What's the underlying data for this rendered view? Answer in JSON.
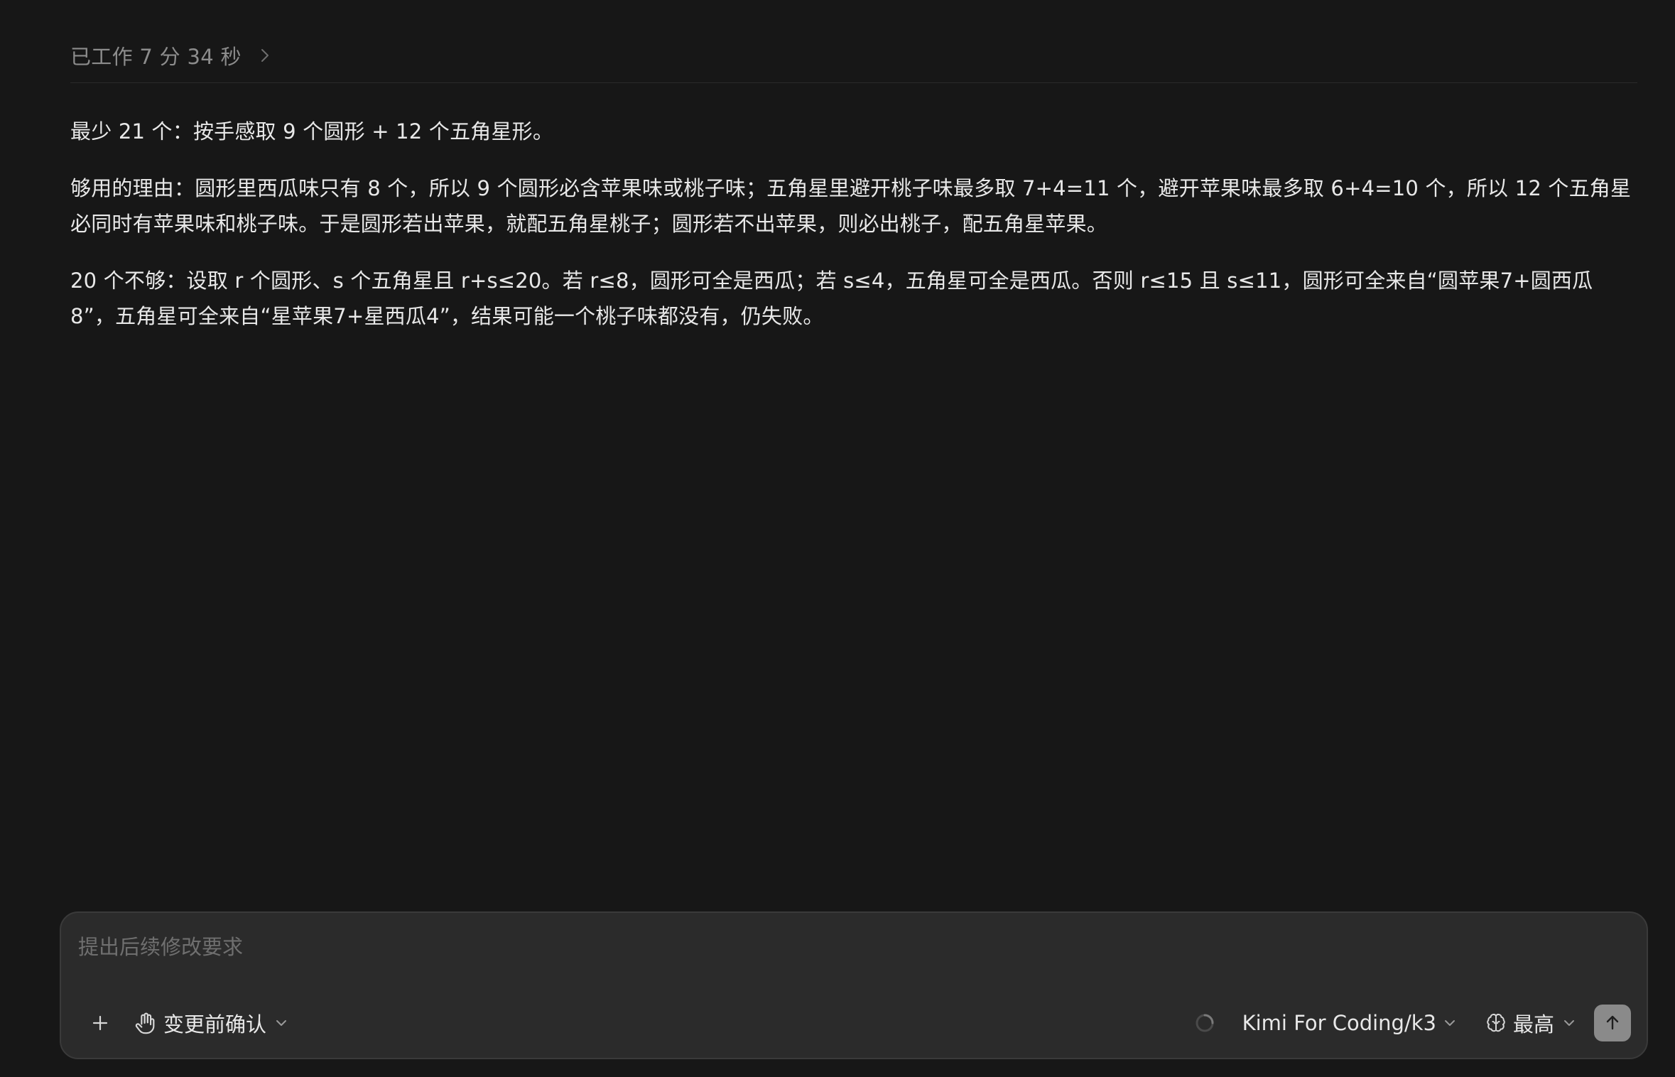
{
  "header": {
    "worked_label": "已工作 7 分 34 秒"
  },
  "message": {
    "paragraphs": [
      "最少 21 个：按手感取 9 个圆形 + 12 个五角星形。",
      "够用的理由：圆形里西瓜味只有 8 个，所以 9 个圆形必含苹果味或桃子味；五角星里避开桃子味最多取 7+4=11 个，避开苹果味最多取 6+4=10 个，所以 12 个五角星必同时有苹果味和桃子味。于是圆形若出苹果，就配五角星桃子；圆形若不出苹果，则必出桃子，配五角星苹果。",
      "20 个不够：设取 r 个圆形、s 个五角星且 r+s≤20。若 r≤8，圆形可全是西瓜；若 s≤4，五角星可全是西瓜。否则 r≤15 且 s≤11，圆形可全来自“圆苹果7+圆西瓜8”，五角星可全来自“星苹果7+星西瓜4”，结果可能一个桃子味都没有，仍失败。"
    ]
  },
  "composer": {
    "placeholder": "提出后续修改要求",
    "value": "",
    "mode_label": "变更前确认",
    "model_label": "Kimi For Coding/k3",
    "effort_label": "最高"
  },
  "icons": {
    "worked_chevron": "chevron-right-icon",
    "add": "plus-icon",
    "mode": "hand-icon",
    "dropdown": "chevron-down-icon",
    "status": "spinner-icon",
    "effort": "brain-icon",
    "send": "arrow-up-icon"
  },
  "colors": {
    "background": "#171717",
    "composer_bg": "#2b2b2b",
    "send_button": "#8a8a8a",
    "text": "#e8e8e8",
    "muted_text": "#8c8c8c"
  }
}
